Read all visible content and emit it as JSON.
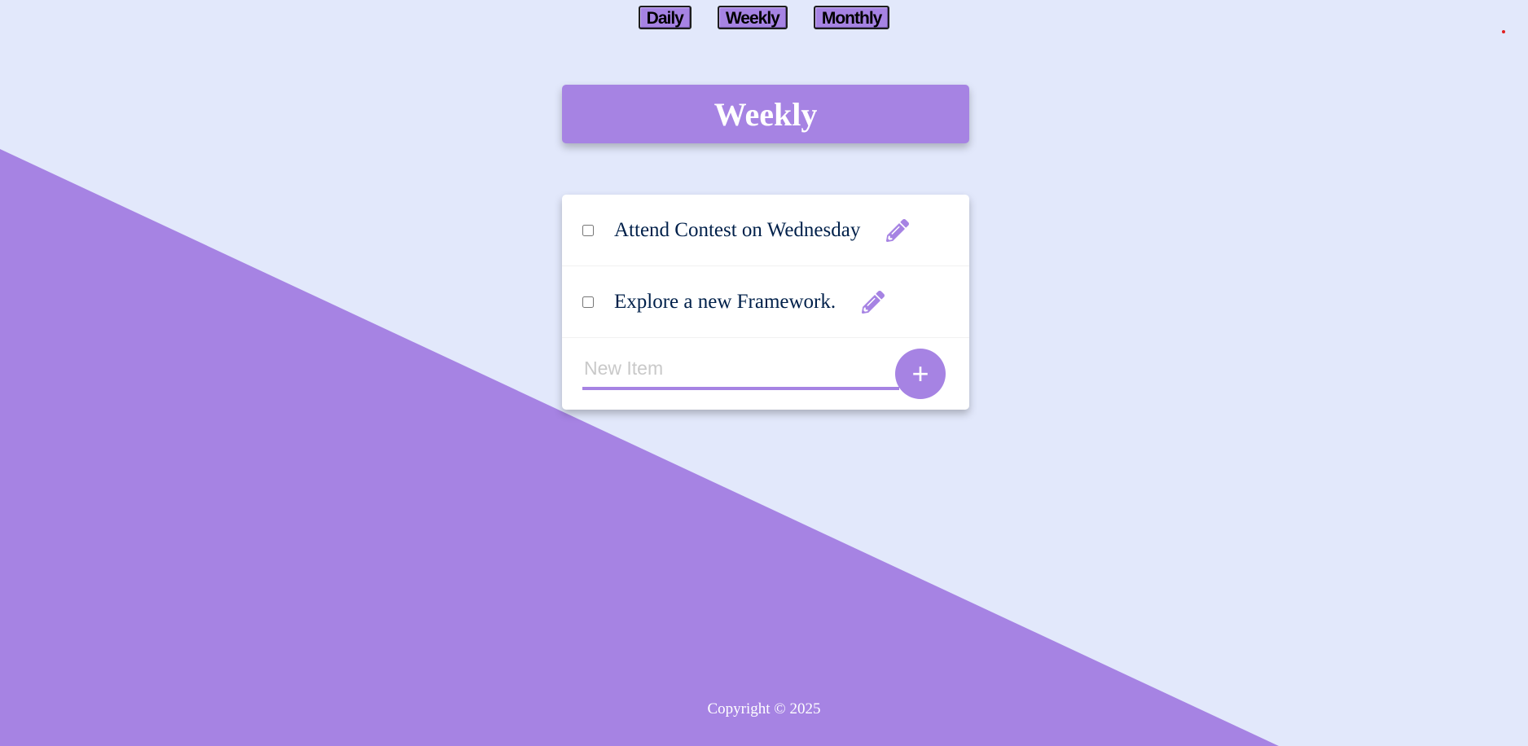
{
  "nav": {
    "buttons": [
      {
        "label": "Daily"
      },
      {
        "label": "Weekly"
      },
      {
        "label": "Monthly"
      }
    ]
  },
  "heading": {
    "title": "Weekly"
  },
  "list": {
    "items": [
      {
        "text": "Attend Contest on Wednesday",
        "checked": false,
        "icon": "pencil-icon"
      },
      {
        "text": "Explore a new Framework.",
        "checked": false,
        "icon": "pencil-icon"
      }
    ],
    "new_item": {
      "placeholder": "New Item",
      "value": ""
    },
    "add_button": {
      "label": "+"
    }
  },
  "footer": {
    "text": "Copyright © 2025"
  },
  "colors": {
    "background": "#e2e8fb",
    "accent": "#a683e3",
    "text": "#00204a"
  }
}
